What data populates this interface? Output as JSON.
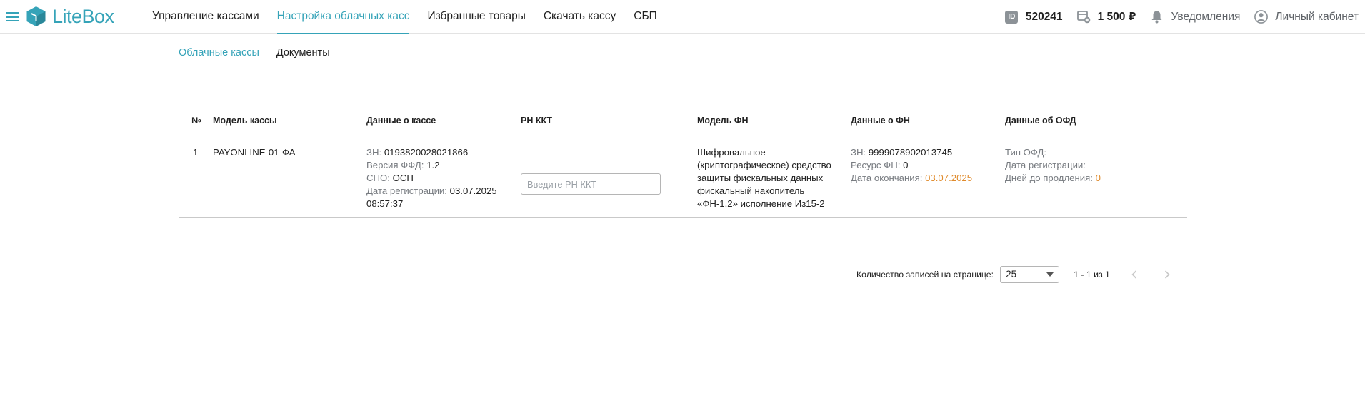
{
  "brand": {
    "name": "LiteBox",
    "accent": "#35a3b8"
  },
  "nav": [
    {
      "label": "Управление кассами"
    },
    {
      "label": "Настройка облачных касс"
    },
    {
      "label": "Избранные товары"
    },
    {
      "label": "Скачать кассу"
    },
    {
      "label": "СБП"
    }
  ],
  "tools": {
    "id_badge": "ID",
    "id_value": "520241",
    "balance": "1 500 ₽",
    "notifications": "Уведомления",
    "account": "Личный кабинет"
  },
  "subtabs": [
    {
      "label": "Облачные кассы"
    },
    {
      "label": "Документы"
    }
  ],
  "table": {
    "headers": [
      "№",
      "Модель кассы",
      "Данные о кассе",
      "РН ККТ",
      "Модель ФН",
      "Данные о ФН",
      "Данные об ОФД"
    ],
    "row": {
      "num": "1",
      "model": "PAYONLINE-01-ФА",
      "kassa": {
        "zn_label": "ЗН:",
        "zn_value": "0193820028021866",
        "ffd_label": "Версия ФФД:",
        "ffd_value": "1.2",
        "sno_label": "СНО:",
        "sno_value": "ОСН",
        "reg_label": "Дата регистрации:",
        "reg_value": "03.07.2025",
        "reg_time": "08:57:37"
      },
      "rn_placeholder": "Введите РН ККТ",
      "fn_model": [
        "Шифровальное",
        "(криптографическое) средство",
        "защиты фискальных данных",
        "фискальный накопитель",
        "«ФН-1.2» исполнение Из15-2"
      ],
      "fn": {
        "zn_label": "ЗН:",
        "zn_value": "9999078902013745",
        "res_label": "Ресурс ФН:",
        "res_value": "0",
        "end_label": "Дата окончания:",
        "end_value": "03.07.2025"
      },
      "ofd": {
        "type_label": "Тип ОФД:",
        "reg_label": "Дата регистрации:",
        "days_label": "Дней до продления:",
        "days_value": "0"
      }
    }
  },
  "pagination": {
    "per_page_label": "Количество записей на странице:",
    "per_page_value": "25",
    "range": "1 - 1 из 1"
  }
}
